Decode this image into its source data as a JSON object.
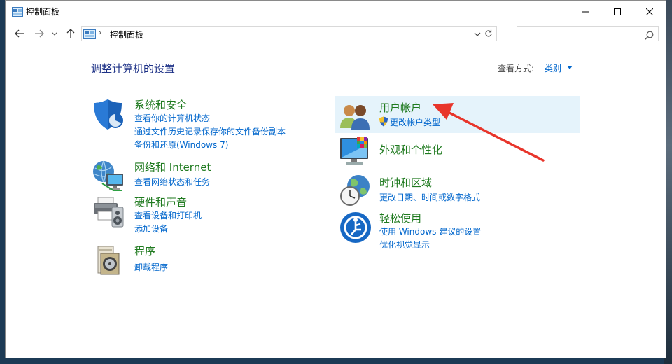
{
  "window": {
    "title": "控制面板"
  },
  "address": {
    "crumb": "控制面板"
  },
  "search": {
    "placeholder": ""
  },
  "main": {
    "heading": "调整计算机的设置",
    "view_by_label": "查看方式:",
    "view_by_value": "类别"
  },
  "categories_left": [
    {
      "title": "系统和安全",
      "icon": "shield-icon",
      "links": [
        "查看你的计算机状态",
        "通过文件历史记录保存你的文件备份副本",
        "备份和还原(Windows 7)"
      ]
    },
    {
      "title": "网络和 Internet",
      "icon": "network-globe-icon",
      "links": [
        "查看网络状态和任务"
      ]
    },
    {
      "title": "硬件和声音",
      "icon": "printer-speaker-icon",
      "links": [
        "查看设备和打印机",
        "添加设备"
      ]
    },
    {
      "title": "程序",
      "icon": "programs-icon",
      "links": [
        "卸载程序"
      ]
    }
  ],
  "categories_right": [
    {
      "title": "用户帐户",
      "icon": "users-icon",
      "links": [
        "更改帐户类型"
      ]
    },
    {
      "title": "外观和个性化",
      "icon": "monitor-icon",
      "links": []
    },
    {
      "title": "时钟和区域",
      "icon": "clock-globe-icon",
      "links": [
        "更改日期、时间或数字格式"
      ]
    },
    {
      "title": "轻松使用",
      "icon": "accessibility-icon",
      "links": [
        "使用 Windows 建议的设置",
        "优化视觉显示"
      ]
    }
  ],
  "colors": {
    "heading": "#1e3287",
    "category_title": "#1f7a1f",
    "link": "#0066cc",
    "highlight": "#e5f3fb",
    "annotation_arrow": "#e8352b"
  }
}
